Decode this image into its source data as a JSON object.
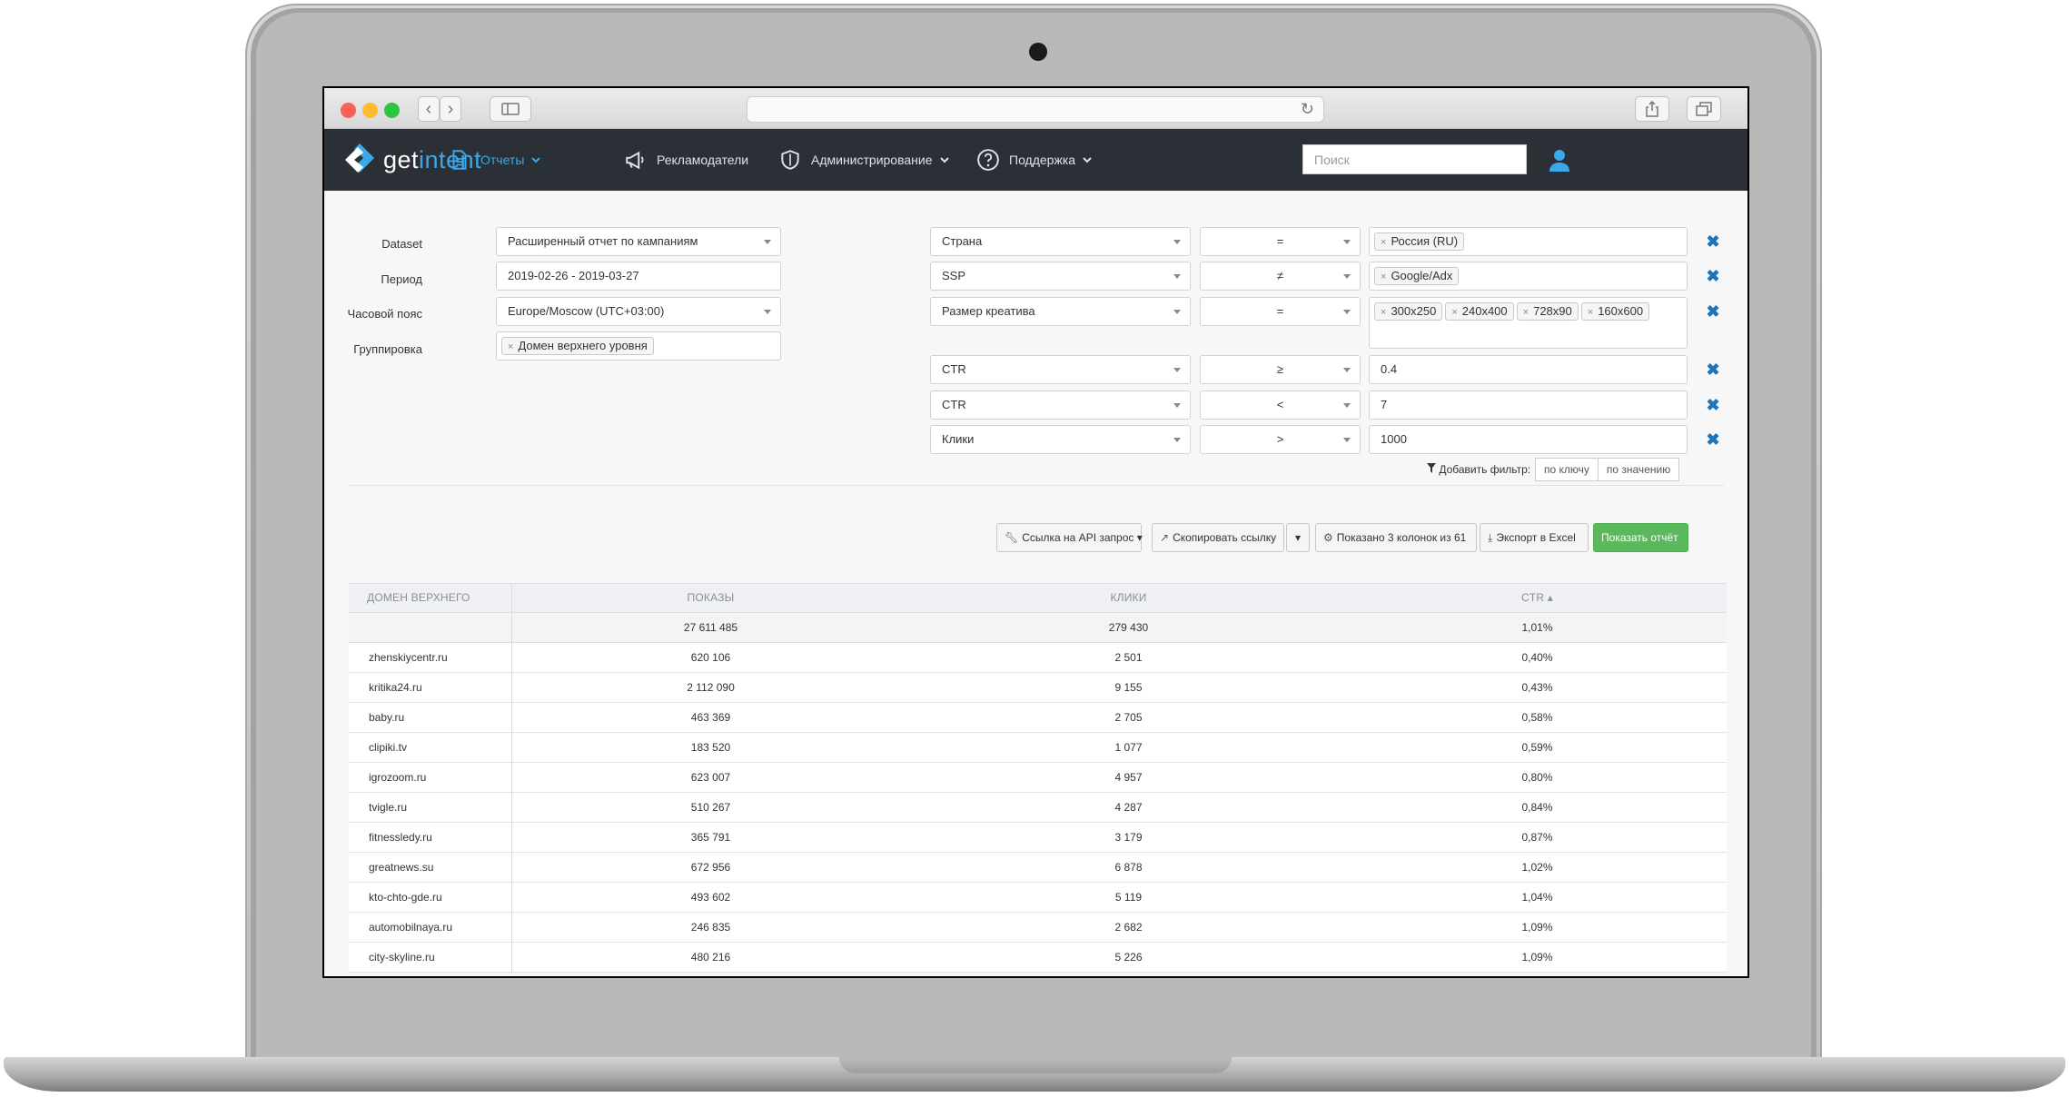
{
  "nav": {
    "logo_a": "get",
    "logo_b": "intent",
    "items": [
      {
        "label": "Отчеты",
        "has_caret": true
      },
      {
        "label": "Рекламодатели",
        "has_caret": false
      },
      {
        "label": "Администрирование",
        "has_caret": true
      },
      {
        "label": "Поддержка",
        "has_caret": true
      }
    ],
    "search_placeholder": "Поиск"
  },
  "form": {
    "dataset_label": "Dataset",
    "dataset_value": "Расширенный отчет по кампаниям",
    "period_label": "Период",
    "period_value": "2019-02-26 - 2019-03-27",
    "tz_label": "Часовой пояс",
    "tz_value": "Europe/Moscow (UTC+03:00)",
    "group_label": "Группировка",
    "group_tag": "Домен верхнего уровня"
  },
  "filters": [
    {
      "field": "Страна",
      "op": "=",
      "tags": [
        "Россия (RU)"
      ]
    },
    {
      "field": "SSP",
      "op": "≠",
      "tags": [
        "Google/Adx"
      ]
    },
    {
      "field": "Размер креатива",
      "op": "=",
      "tags": [
        "300x250",
        "240x400",
        "728x90",
        "160x600"
      ]
    },
    {
      "field": "CTR",
      "op": "≥",
      "value": "0.4"
    },
    {
      "field": "CTR",
      "op": "<",
      "value": "7"
    },
    {
      "field": "Клики",
      "op": ">",
      "value": "1000"
    }
  ],
  "add_filter": {
    "label": "Добавить фильтр:",
    "by_key": "по ключу",
    "by_value": "по значению"
  },
  "toolbar": {
    "api_link": "Ссылка на API запрос",
    "copy_link": "Скопировать ссылку",
    "columns": "Показано 3 колонок из 61",
    "export": "Экспорт в Excel",
    "show": "Показать отчёт"
  },
  "table": {
    "headers": [
      "Домен верхнего уровня",
      "Показы",
      "Клики",
      "CTR"
    ],
    "sort_col": "CTR",
    "totals": [
      "",
      "27 611 485",
      "279 430",
      "1,01%"
    ],
    "rows": [
      [
        "zhenskiycentr.ru",
        "620 106",
        "2 501",
        "0,40%"
      ],
      [
        "kritika24.ru",
        "2 112 090",
        "9 155",
        "0,43%"
      ],
      [
        "baby.ru",
        "463 369",
        "2 705",
        "0,58%"
      ],
      [
        "clipiki.tv",
        "183 520",
        "1 077",
        "0,59%"
      ],
      [
        "igrozoom.ru",
        "623 007",
        "4 957",
        "0,80%"
      ],
      [
        "tvigle.ru",
        "510 267",
        "4 287",
        "0,84%"
      ],
      [
        "fitnessledy.ru",
        "365 791",
        "3 179",
        "0,87%"
      ],
      [
        "greatnews.su",
        "672 956",
        "6 878",
        "1,02%"
      ],
      [
        "kto-chto-gde.ru",
        "493 602",
        "5 119",
        "1,04%"
      ],
      [
        "automobilnaya.ru",
        "246 835",
        "2 682",
        "1,09%"
      ],
      [
        "city-skyline.ru",
        "480 216",
        "5 226",
        "1,09%"
      ]
    ]
  },
  "colors": {
    "accent": "#3ba9e8",
    "topbar": "#2b2f36",
    "primary_button": "#5cb85c",
    "delete": "#1f73b7"
  }
}
